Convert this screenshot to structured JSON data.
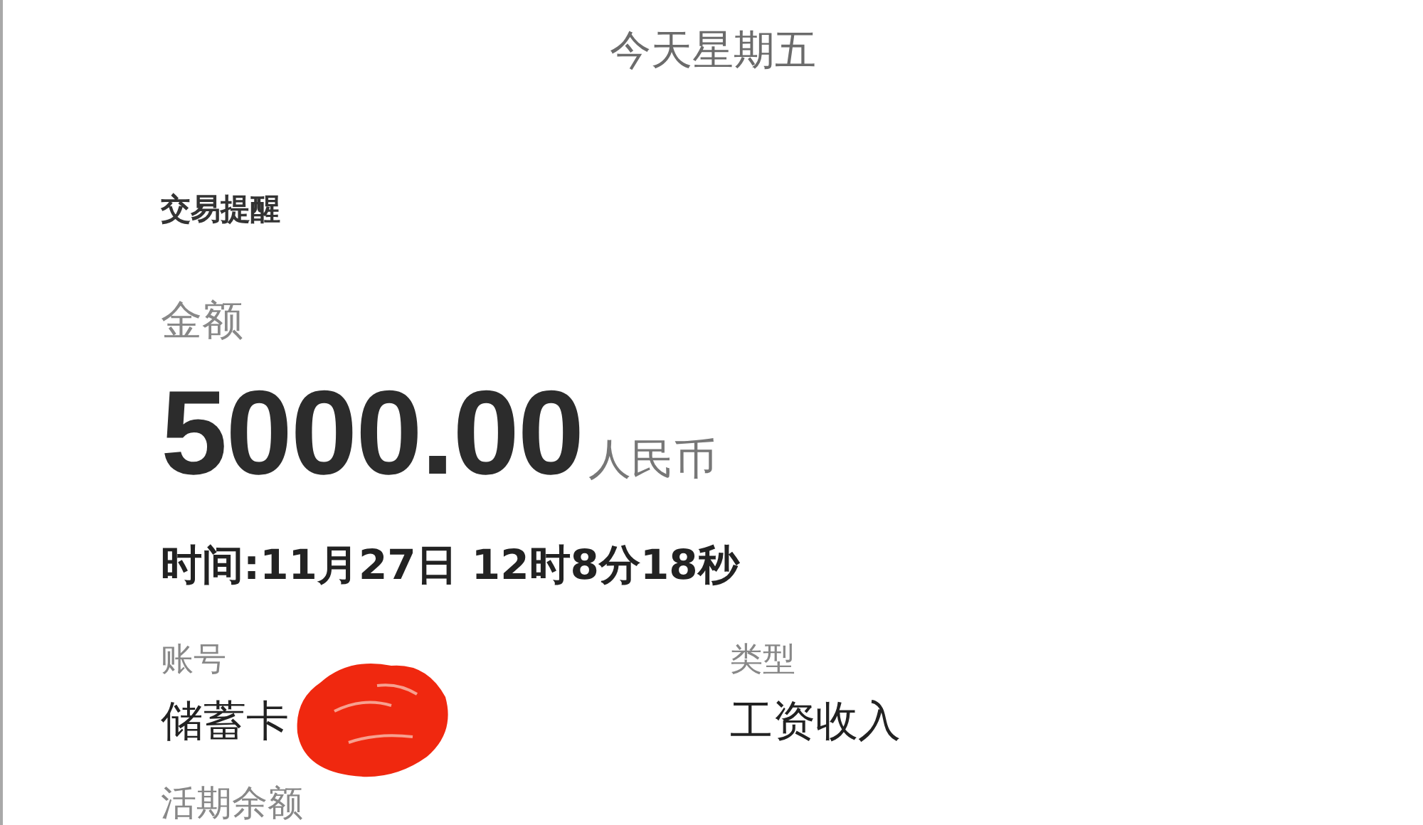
{
  "header": {
    "title": "今天星期五"
  },
  "notification": {
    "title": "交易提醒",
    "amount_label": "金额",
    "amount": "5000.00",
    "currency": "人民币",
    "time": "时间:11月27日 12时8分18秒",
    "fields": [
      {
        "label": "账号",
        "value": "储蓄卡",
        "redacted": true
      },
      {
        "label": "类型",
        "value": "工资收入",
        "redacted": false
      }
    ],
    "balance_label": "活期余额"
  }
}
